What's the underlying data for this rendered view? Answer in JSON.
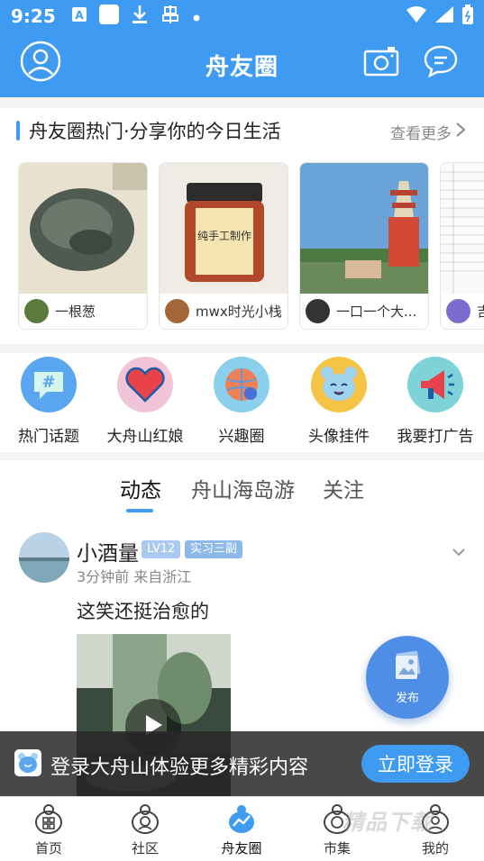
{
  "status_bar": {
    "time": "9:25",
    "left_icons": [
      "a-notification-icon",
      "square-notification-icon",
      "download-icon",
      "bug-icon",
      "dot-icon"
    ],
    "right_icons": [
      "wifi-icon",
      "signal-icon",
      "battery-icon"
    ]
  },
  "header": {
    "title": "舟友圈",
    "left_icon": "profile-icon",
    "right_icons": [
      "camera-icon",
      "message-icon"
    ]
  },
  "hot": {
    "title": "舟友圈热门·分享你的今日生活",
    "more_label": "查看更多",
    "cards": [
      {
        "author": "一根葱"
      },
      {
        "author": "mwx时光小栈",
        "image_text": "纯手工制作"
      },
      {
        "author": "一口一个大..."
      },
      {
        "author": "吉"
      }
    ]
  },
  "shortcuts": [
    {
      "label": "热门话题",
      "icon": "hashtag-bubble-icon",
      "color": "#5aa6f0"
    },
    {
      "label": "大舟山红娘",
      "icon": "heart-icon",
      "color": "#e8434a"
    },
    {
      "label": "兴趣圈",
      "icon": "interest-circle-icon",
      "color": "#ef7f55"
    },
    {
      "label": "头像挂件",
      "icon": "mascot-face-icon",
      "color": "#f6c445"
    },
    {
      "label": "我要打广告",
      "icon": "megaphone-icon",
      "color": "#7dd3d8"
    }
  ],
  "feed": {
    "tabs": [
      {
        "label": "动态",
        "active": true
      },
      {
        "label": "舟山海岛游",
        "active": false
      },
      {
        "label": "关注",
        "active": false
      }
    ],
    "post": {
      "username": "小酒量",
      "level_badge": "LV12",
      "title_badge": "实习三副",
      "time": "3分钟前 来自浙江",
      "text": "这笑还挺治愈的"
    }
  },
  "fab": {
    "label": "发布",
    "icon": "photo-upload-icon"
  },
  "login_banner": {
    "text": "登录大舟山体验更多精彩内容",
    "button": "立即登录"
  },
  "bottom_nav": [
    {
      "label": "首页",
      "icon": "home-icon",
      "active": false
    },
    {
      "label": "社区",
      "icon": "community-icon",
      "active": false
    },
    {
      "label": "舟友圈",
      "icon": "friends-circle-icon",
      "active": true
    },
    {
      "label": "市集",
      "icon": "market-icon",
      "active": false
    },
    {
      "label": "我的",
      "icon": "me-icon",
      "active": false
    }
  ],
  "watermark": "精品下载",
  "colors": {
    "primary": "#3f9bf1",
    "fab": "#4e8ee6",
    "badge_level": "#a9c9ef",
    "badge_title": "#8cb8ea"
  }
}
